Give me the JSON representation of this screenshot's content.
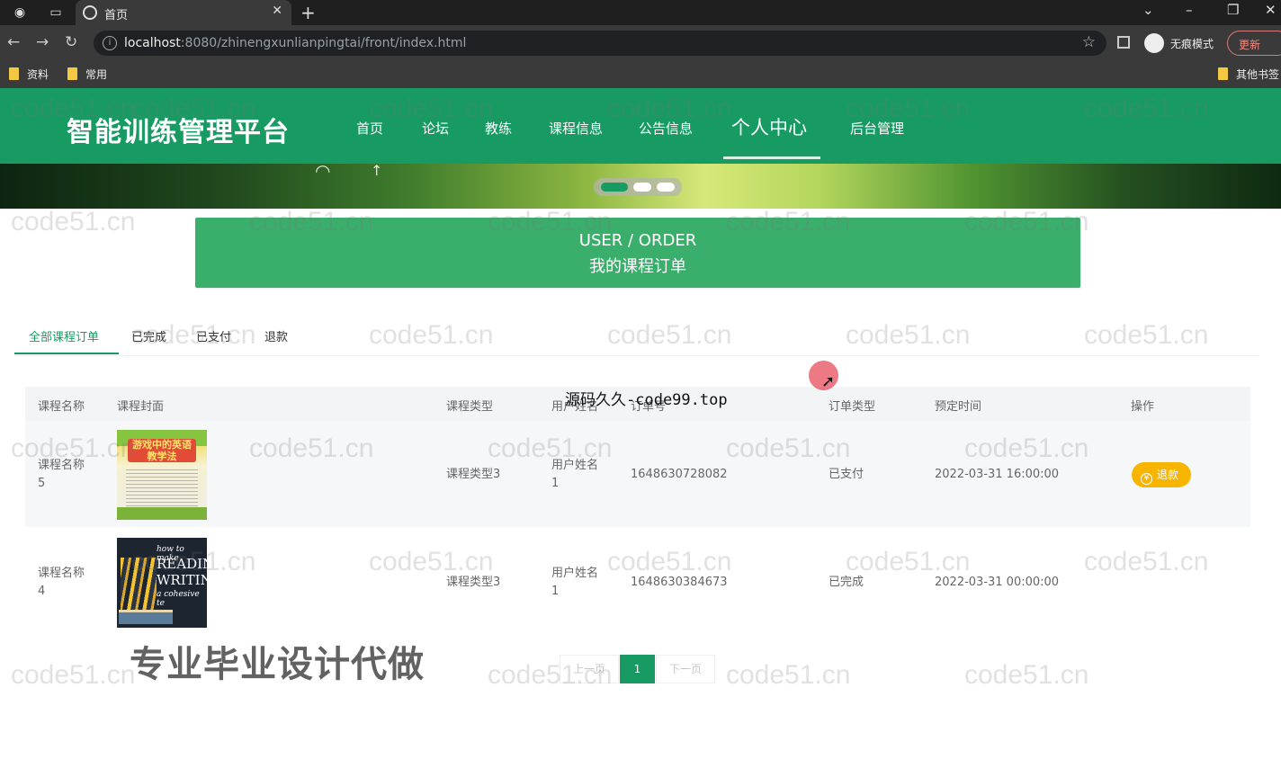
{
  "browser": {
    "tab_title": "首页",
    "url_host": "localhost",
    "url_path": ":8080/zhinengxunlianpingtai/front/index.html",
    "incognito_label": "无痕模式",
    "update_label": "更新",
    "bookmarks": [
      "资料",
      "常用"
    ],
    "other_bookmarks": "其他书签"
  },
  "site": {
    "logo": "智能训练管理平台",
    "nav": [
      "首页",
      "论坛",
      "教练",
      "课程信息",
      "公告信息",
      "个人中心",
      "后台管理"
    ],
    "active_nav": "个人中心"
  },
  "section": {
    "title_en": "USER / ORDER",
    "title_cn": "我的课程订单"
  },
  "tabs": [
    "全部课程订单",
    "已完成",
    "已支付",
    "退款"
  ],
  "table": {
    "headers": [
      "课程名称",
      "课程封面",
      "课程类型",
      "用户姓名",
      "订单号",
      "订单类型",
      "预定时间",
      "操作"
    ],
    "rows": [
      {
        "name": "课程名称",
        "name_no": "5",
        "type": "课程类型3",
        "user": "用户姓名",
        "user_no": "1",
        "order_no": "1648630728082",
        "order_type": "已支付",
        "time": "2022-03-31 16:00:00",
        "action": "退款"
      },
      {
        "name": "课程名称",
        "name_no": "4",
        "type": "课程类型3",
        "user": "用户姓名",
        "user_no": "1",
        "order_no": "1648630384673",
        "order_type": "已完成",
        "time": "2022-03-31 00:00:00",
        "action": ""
      }
    ]
  },
  "covers": {
    "cover1_text": "游戏中的英语 教学法",
    "cover2_lines": [
      "how to make",
      "READING",
      "WRITIN",
      "a cohesive te"
    ]
  },
  "pagination": {
    "prev": "上一页",
    "current": "1",
    "next": "下一页"
  },
  "overlay": {
    "top_text": "源码久久-code99.top",
    "bottom_text": "专业毕业设计代做",
    "watermark": "code51.cn"
  },
  "icons": {
    "refund": "refund-icon",
    "cursor": "cursor-icon"
  },
  "colors": {
    "brand_green": "#189a63",
    "title_green": "#3aaf6c",
    "refund_yellow": "#f7b500"
  }
}
